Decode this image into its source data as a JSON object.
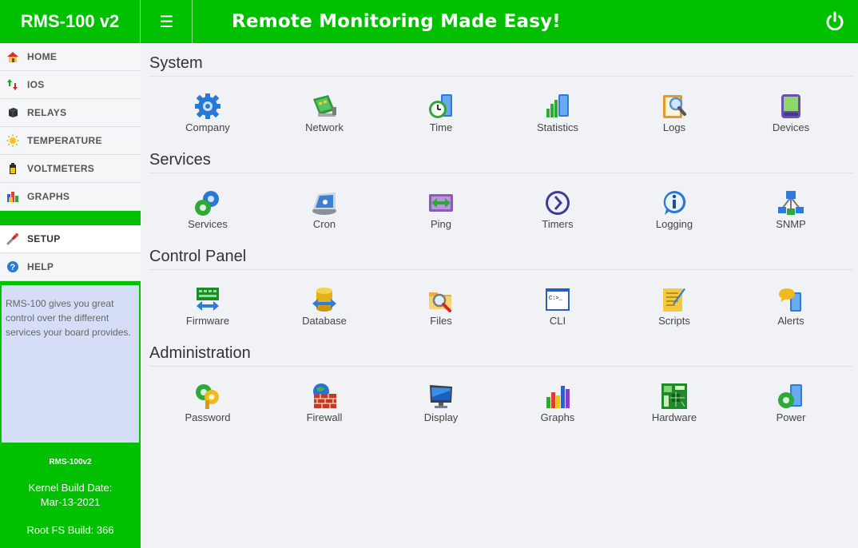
{
  "header": {
    "brand": "RMS-100 v2",
    "tagline": "Remote Monitoring Made Easy!",
    "menu_icon": "hamburger-icon",
    "power_icon": "power-icon"
  },
  "colors": {
    "brand_green": "#00c000",
    "info_bg": "#d5def6",
    "main_bg": "#f1f2f6"
  },
  "sidebar": {
    "items": [
      {
        "label": "HOME",
        "icon": "home-icon"
      },
      {
        "label": "IOS",
        "icon": "io-arrows-icon"
      },
      {
        "label": "RELAYS",
        "icon": "relay-icon"
      },
      {
        "label": "TEMPERATURE",
        "icon": "sun-icon"
      },
      {
        "label": "VOLTMETERS",
        "icon": "battery-icon"
      },
      {
        "label": "GRAPHS",
        "icon": "bar-chart-icon"
      }
    ],
    "items2": [
      {
        "label": "SETUP",
        "icon": "wrench-icon"
      },
      {
        "label": "HELP",
        "icon": "help-icon"
      }
    ],
    "info": "RMS-100 gives you great control over the different services your board provides.",
    "model": "RMS-100v2",
    "kernel_label": "Kernel Build Date:",
    "kernel_date": "Mar-13-2021",
    "rootfs": "Root FS Build: 366"
  },
  "sections": [
    {
      "title": "System",
      "tiles": [
        {
          "label": "Company",
          "icon": "gear-icon"
        },
        {
          "label": "Network",
          "icon": "network-card-icon"
        },
        {
          "label": "Time",
          "icon": "clock-icon"
        },
        {
          "label": "Statistics",
          "icon": "statistics-icon"
        },
        {
          "label": "Logs",
          "icon": "logs-icon"
        },
        {
          "label": "Devices",
          "icon": "device-icon"
        }
      ]
    },
    {
      "title": "Services",
      "tiles": [
        {
          "label": "Services",
          "icon": "services-gear-icon"
        },
        {
          "label": "Cron",
          "icon": "cron-icon"
        },
        {
          "label": "Ping",
          "icon": "ping-icon"
        },
        {
          "label": "Timers",
          "icon": "timer-icon"
        },
        {
          "label": "Logging",
          "icon": "info-icon"
        },
        {
          "label": "SNMP",
          "icon": "snmp-icon"
        }
      ]
    },
    {
      "title": "Control Panel",
      "tiles": [
        {
          "label": "Firmware",
          "icon": "firmware-icon"
        },
        {
          "label": "Database",
          "icon": "database-icon"
        },
        {
          "label": "Files",
          "icon": "folder-search-icon"
        },
        {
          "label": "CLI",
          "icon": "terminal-icon"
        },
        {
          "label": "Scripts",
          "icon": "script-icon"
        },
        {
          "label": "Alerts",
          "icon": "alert-icon"
        }
      ]
    },
    {
      "title": "Administration",
      "tiles": [
        {
          "label": "Password",
          "icon": "key-icon"
        },
        {
          "label": "Firewall",
          "icon": "firewall-icon"
        },
        {
          "label": "Display",
          "icon": "monitor-icon"
        },
        {
          "label": "Graphs",
          "icon": "graph-bars-icon"
        },
        {
          "label": "Hardware",
          "icon": "circuit-board-icon"
        },
        {
          "label": "Power",
          "icon": "power-server-icon"
        }
      ]
    }
  ]
}
